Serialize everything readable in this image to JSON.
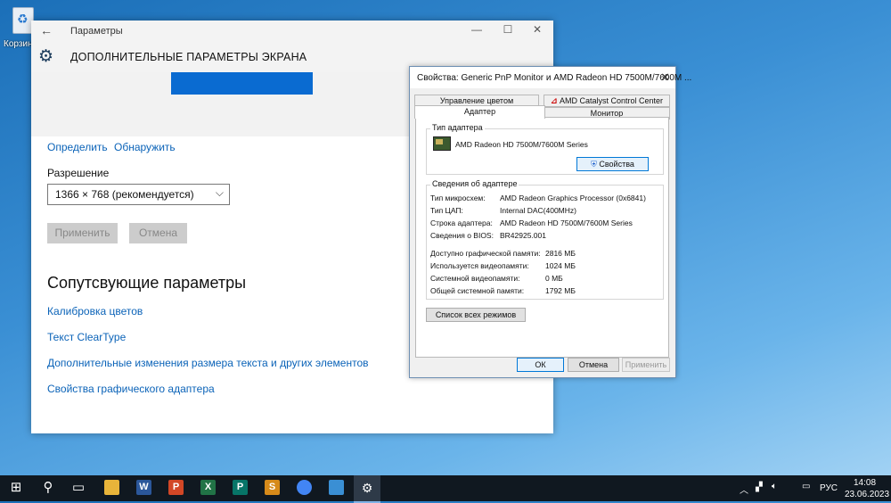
{
  "desktop": {
    "recycle_bin_label": "Корзина"
  },
  "settings_window": {
    "title": "Параметры",
    "header_title": "ДОПОЛНИТЕЛЬНЫЕ ПАРАМЕТРЫ ЭКРАНА",
    "identify_link": "Определить",
    "detect_link": "Обнаружить",
    "resolution_label": "Разрешение",
    "resolution_value": "1366 × 768 (рекомендуется)",
    "apply_button": "Применить",
    "cancel_button": "Отмена",
    "related_heading": "Сопутсвующие параметры",
    "links": {
      "color_calibration": "Калибровка цветов",
      "cleartype": "Текст ClearType",
      "text_size": "Дополнительные изменения размера текста и других элементов",
      "adapter_props": "Свойства графического адаптера"
    }
  },
  "dialog": {
    "title": "Свойства: Generic PnP Monitor и AMD Radeon HD 7500M/7600M ...",
    "tabs": {
      "color_mgmt": "Управление цветом",
      "amd_catalyst": "AMD Catalyst Control Center",
      "adapter": "Адаптер",
      "monitor": "Монитор"
    },
    "adapter_type_group": "Тип адаптера",
    "adapter_name": "AMD Radeon HD 7500M/7600M Series",
    "properties_button": "Свойства",
    "adapter_info_group": "Сведения об адаптере",
    "info": [
      {
        "label": "Тип микросхем:",
        "value": "AMD Radeon Graphics Processor (0x6841)"
      },
      {
        "label": "Тип ЦАП:",
        "value": "Internal DAC(400MHz)"
      },
      {
        "label": "Строка адаптера:",
        "value": "AMD Radeon HD 7500M/7600M Series"
      },
      {
        "label": "Сведения о BIOS:",
        "value": "BR42925.001"
      }
    ],
    "memory": [
      {
        "label": "Доступно графической памяти:",
        "value": "2816 МБ"
      },
      {
        "label": "Используется видеопамяти:",
        "value": "1024 МБ"
      },
      {
        "label": "Системной видеопамяти:",
        "value": "0 МБ"
      },
      {
        "label": "Общей системной памяти:",
        "value": "1792 МБ"
      }
    ],
    "list_modes_button": "Список всех режимов",
    "ok_button": "ОК",
    "cancel_button": "Отмена",
    "apply_button": "Применить"
  },
  "taskbar": {
    "language": "РУС",
    "time": "14:08",
    "date": "23.06.2023",
    "apps": [
      {
        "name": "file-explorer-icon",
        "letter": "",
        "color": "#e8b43a"
      },
      {
        "name": "word-icon",
        "letter": "W",
        "color": "#2b579a"
      },
      {
        "name": "powerpoint-icon",
        "letter": "P",
        "color": "#d24726"
      },
      {
        "name": "excel-icon",
        "letter": "X",
        "color": "#217346"
      },
      {
        "name": "publisher-icon",
        "letter": "P",
        "color": "#077568"
      },
      {
        "name": "slides-icon",
        "letter": "S",
        "color": "#d68a1a"
      },
      {
        "name": "chrome-icon",
        "letter": "",
        "color": "#4285f4"
      },
      {
        "name": "remote-desktop-icon",
        "letter": "",
        "color": "#3a8fd4"
      }
    ]
  }
}
